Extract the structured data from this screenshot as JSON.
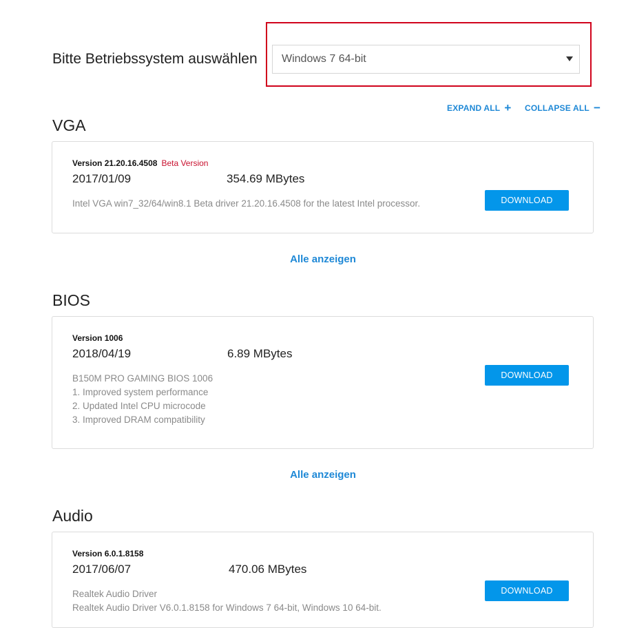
{
  "os_selector": {
    "label": "Bitte Betriebssystem auswählen",
    "selected": "Windows 7 64-bit"
  },
  "controls": {
    "expand_all": "EXPAND ALL",
    "expand_symbol": "+",
    "collapse_all": "COLLAPSE ALL",
    "collapse_symbol": "−"
  },
  "sections": [
    {
      "title": "VGA",
      "version": "Version 21.20.16.4508",
      "badge": "Beta Version",
      "date": "2017/01/09",
      "size": "354.69 MBytes",
      "description": [
        "Intel VGA win7_32/64/win8.1 Beta driver 21.20.16.4508 for the latest Intel processor."
      ],
      "download_label": "DOWNLOAD",
      "show_all": "Alle anzeigen"
    },
    {
      "title": "BIOS",
      "version": "Version 1006",
      "date": "2018/04/19",
      "size": "6.89 MBytes",
      "description": [
        "B150M PRO GAMING BIOS 1006",
        "1. Improved system performance",
        "2. Updated Intel CPU microcode",
        "3. Improved DRAM compatibility"
      ],
      "download_label": "DOWNLOAD",
      "show_all": "Alle anzeigen"
    },
    {
      "title": "Audio",
      "version": "Version 6.0.1.8158",
      "date": "2017/06/07",
      "size": "470.06 MBytes",
      "description": [
        "Realtek Audio Driver",
        "Realtek Audio Driver V6.0.1.8158 for Windows 7 64-bit, Windows 10 64-bit."
      ],
      "download_label": "DOWNLOAD"
    }
  ],
  "colors": {
    "accent": "#1e88d6",
    "button": "#0396ea",
    "highlight": "#d0021b",
    "beta": "#c8102e"
  }
}
